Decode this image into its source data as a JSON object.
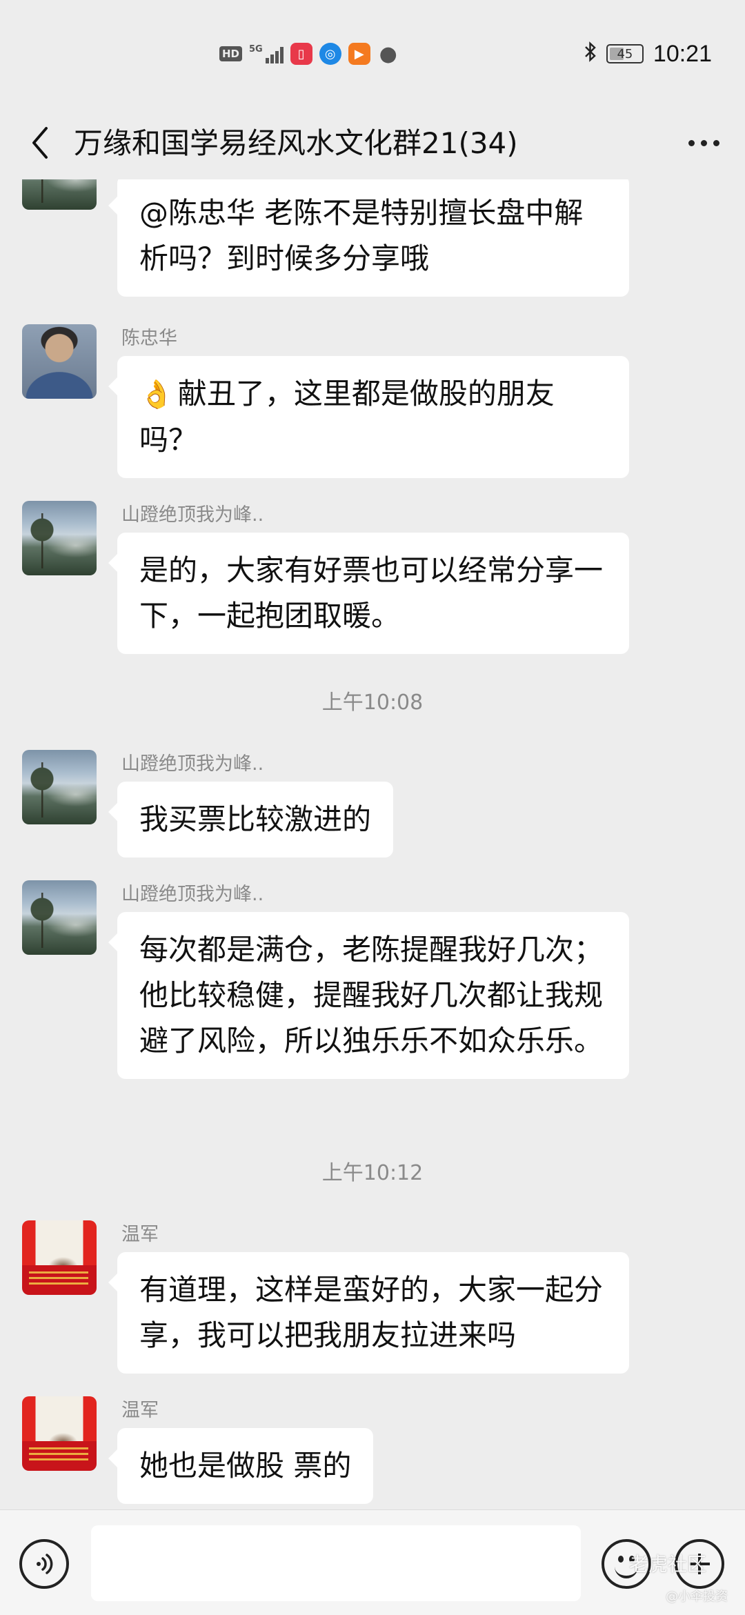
{
  "status_bar": {
    "hd": "HD",
    "network": "5G",
    "battery": "45",
    "time": "10:21"
  },
  "header": {
    "title": "万缘和国学易经风水文化群21(34)"
  },
  "messages": [
    {
      "sender": "",
      "text": "@陈忠华  老陈不是特别擅长盘中解析吗？到时候多分享哦"
    },
    {
      "sender": "陈忠华",
      "emoji": "👌",
      "text": "献丑了，这里都是做股的朋友吗？"
    },
    {
      "sender": "山蹬绝顶我为峰..",
      "text": "是的，大家有好票也可以经常分享一下，一起抱团取暖。"
    },
    {
      "sender": "山蹬绝顶我为峰..",
      "text": "我买票比较激进的"
    },
    {
      "sender": "山蹬绝顶我为峰..",
      "text": "每次都是满仓，老陈提醒我好几次；他比较稳健，提醒我好几次都让我规避了风险，所以独乐乐不如众乐乐。"
    },
    {
      "sender": "温军",
      "text": "有道理，这样是蛮好的，大家一起分享，我可以把我朋友拉进来吗"
    },
    {
      "sender": "温军",
      "text": "她也是做股 票的"
    }
  ],
  "timestamps": [
    "上午10:08",
    "上午10:12"
  ],
  "input_bar": {
    "placeholder": ""
  },
  "watermark": {
    "main": "老虎社区",
    "sub": "@小伞投资"
  }
}
